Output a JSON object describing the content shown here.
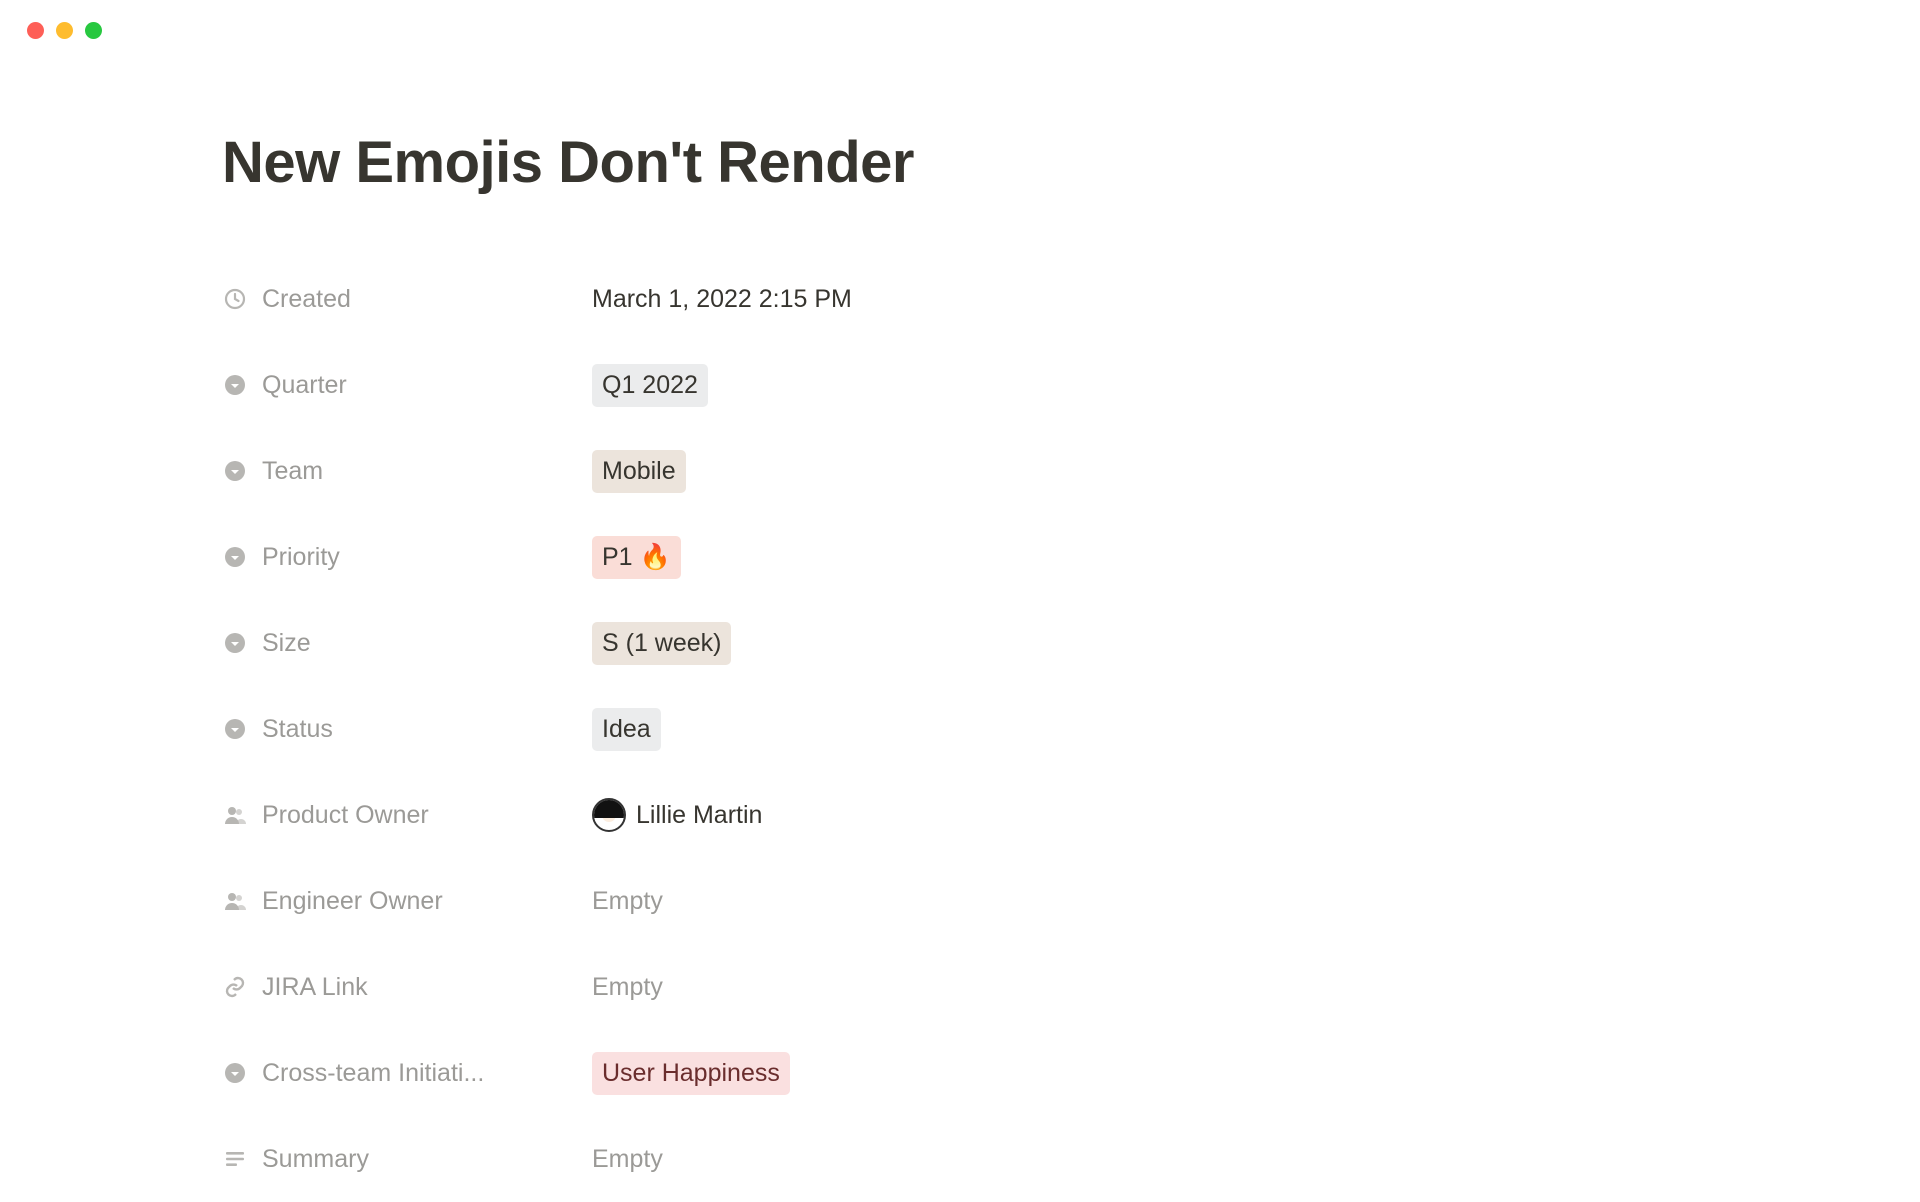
{
  "page": {
    "title": "New Emojis Don't Render"
  },
  "properties": {
    "created": {
      "label": "Created",
      "value": "March 1, 2022 2:15 PM"
    },
    "quarter": {
      "label": "Quarter",
      "value": "Q1 2022"
    },
    "team": {
      "label": "Team",
      "value": "Mobile"
    },
    "priority": {
      "label": "Priority",
      "value": "P1 🔥"
    },
    "size": {
      "label": "Size",
      "value": "S (1 week)"
    },
    "status": {
      "label": "Status",
      "value": "Idea"
    },
    "product_owner": {
      "label": "Product Owner",
      "value": "Lillie Martin"
    },
    "engineer_owner": {
      "label": "Engineer Owner",
      "value": "Empty"
    },
    "jira_link": {
      "label": "JIRA Link",
      "value": "Empty"
    },
    "cross_team": {
      "label": "Cross-team Initiati...",
      "value": "User Happiness"
    },
    "summary": {
      "label": "Summary",
      "value": "Empty"
    }
  }
}
